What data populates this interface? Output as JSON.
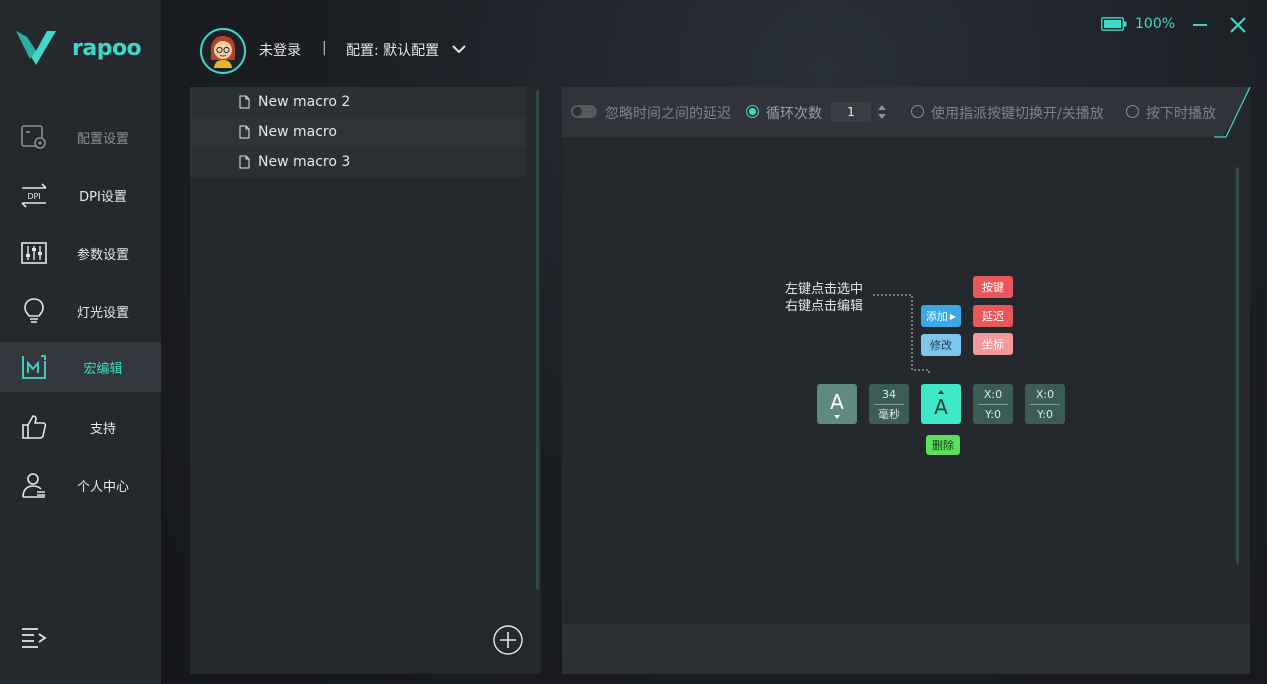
{
  "app": {
    "brand": "rapoo"
  },
  "sidebar": {
    "items": [
      {
        "label": "配置设置",
        "icon": "config-icon",
        "state": "dim"
      },
      {
        "label": "DPI设置",
        "icon": "dpi-icon",
        "state": "normal"
      },
      {
        "label": "参数设置",
        "icon": "sliders-icon",
        "state": "normal"
      },
      {
        "label": "灯光设置",
        "icon": "bulb-icon",
        "state": "normal"
      },
      {
        "label": "宏编辑",
        "icon": "macro-icon",
        "state": "active"
      },
      {
        "label": "支持",
        "icon": "thumbs-up-icon",
        "state": "normal"
      },
      {
        "label": "个人中心",
        "icon": "user-icon",
        "state": "normal"
      }
    ]
  },
  "header": {
    "user": "未登录",
    "separator": "|",
    "profile": "配置: 默认配置",
    "battery": "100%"
  },
  "macros": {
    "items": [
      "New macro 2",
      "New macro",
      "New macro 3"
    ]
  },
  "toolbar": {
    "ignore_delay": "忽略时间之间的延迟",
    "loop_label": "循环次数",
    "loop_value": "1",
    "toggle_play": "使用指派按键切换开/关播放",
    "hold_play": "按下时播放"
  },
  "guide": {
    "hint_left": "左键点击选中",
    "hint_right": "右键点击编辑",
    "add": "添加",
    "modify": "修改",
    "key_btn": "按键",
    "delay_btn": "延迟",
    "coord_btn": "坐标",
    "delete": "删除",
    "key_letter": "A",
    "delay_value": "34",
    "delay_unit": "毫秒",
    "coord_x": "X:0",
    "coord_y": "Y:0"
  },
  "colors": {
    "accent": "#3fd9c9",
    "panel": "#25282d",
    "red": "#e8575a",
    "blue": "#3aa7e6"
  }
}
